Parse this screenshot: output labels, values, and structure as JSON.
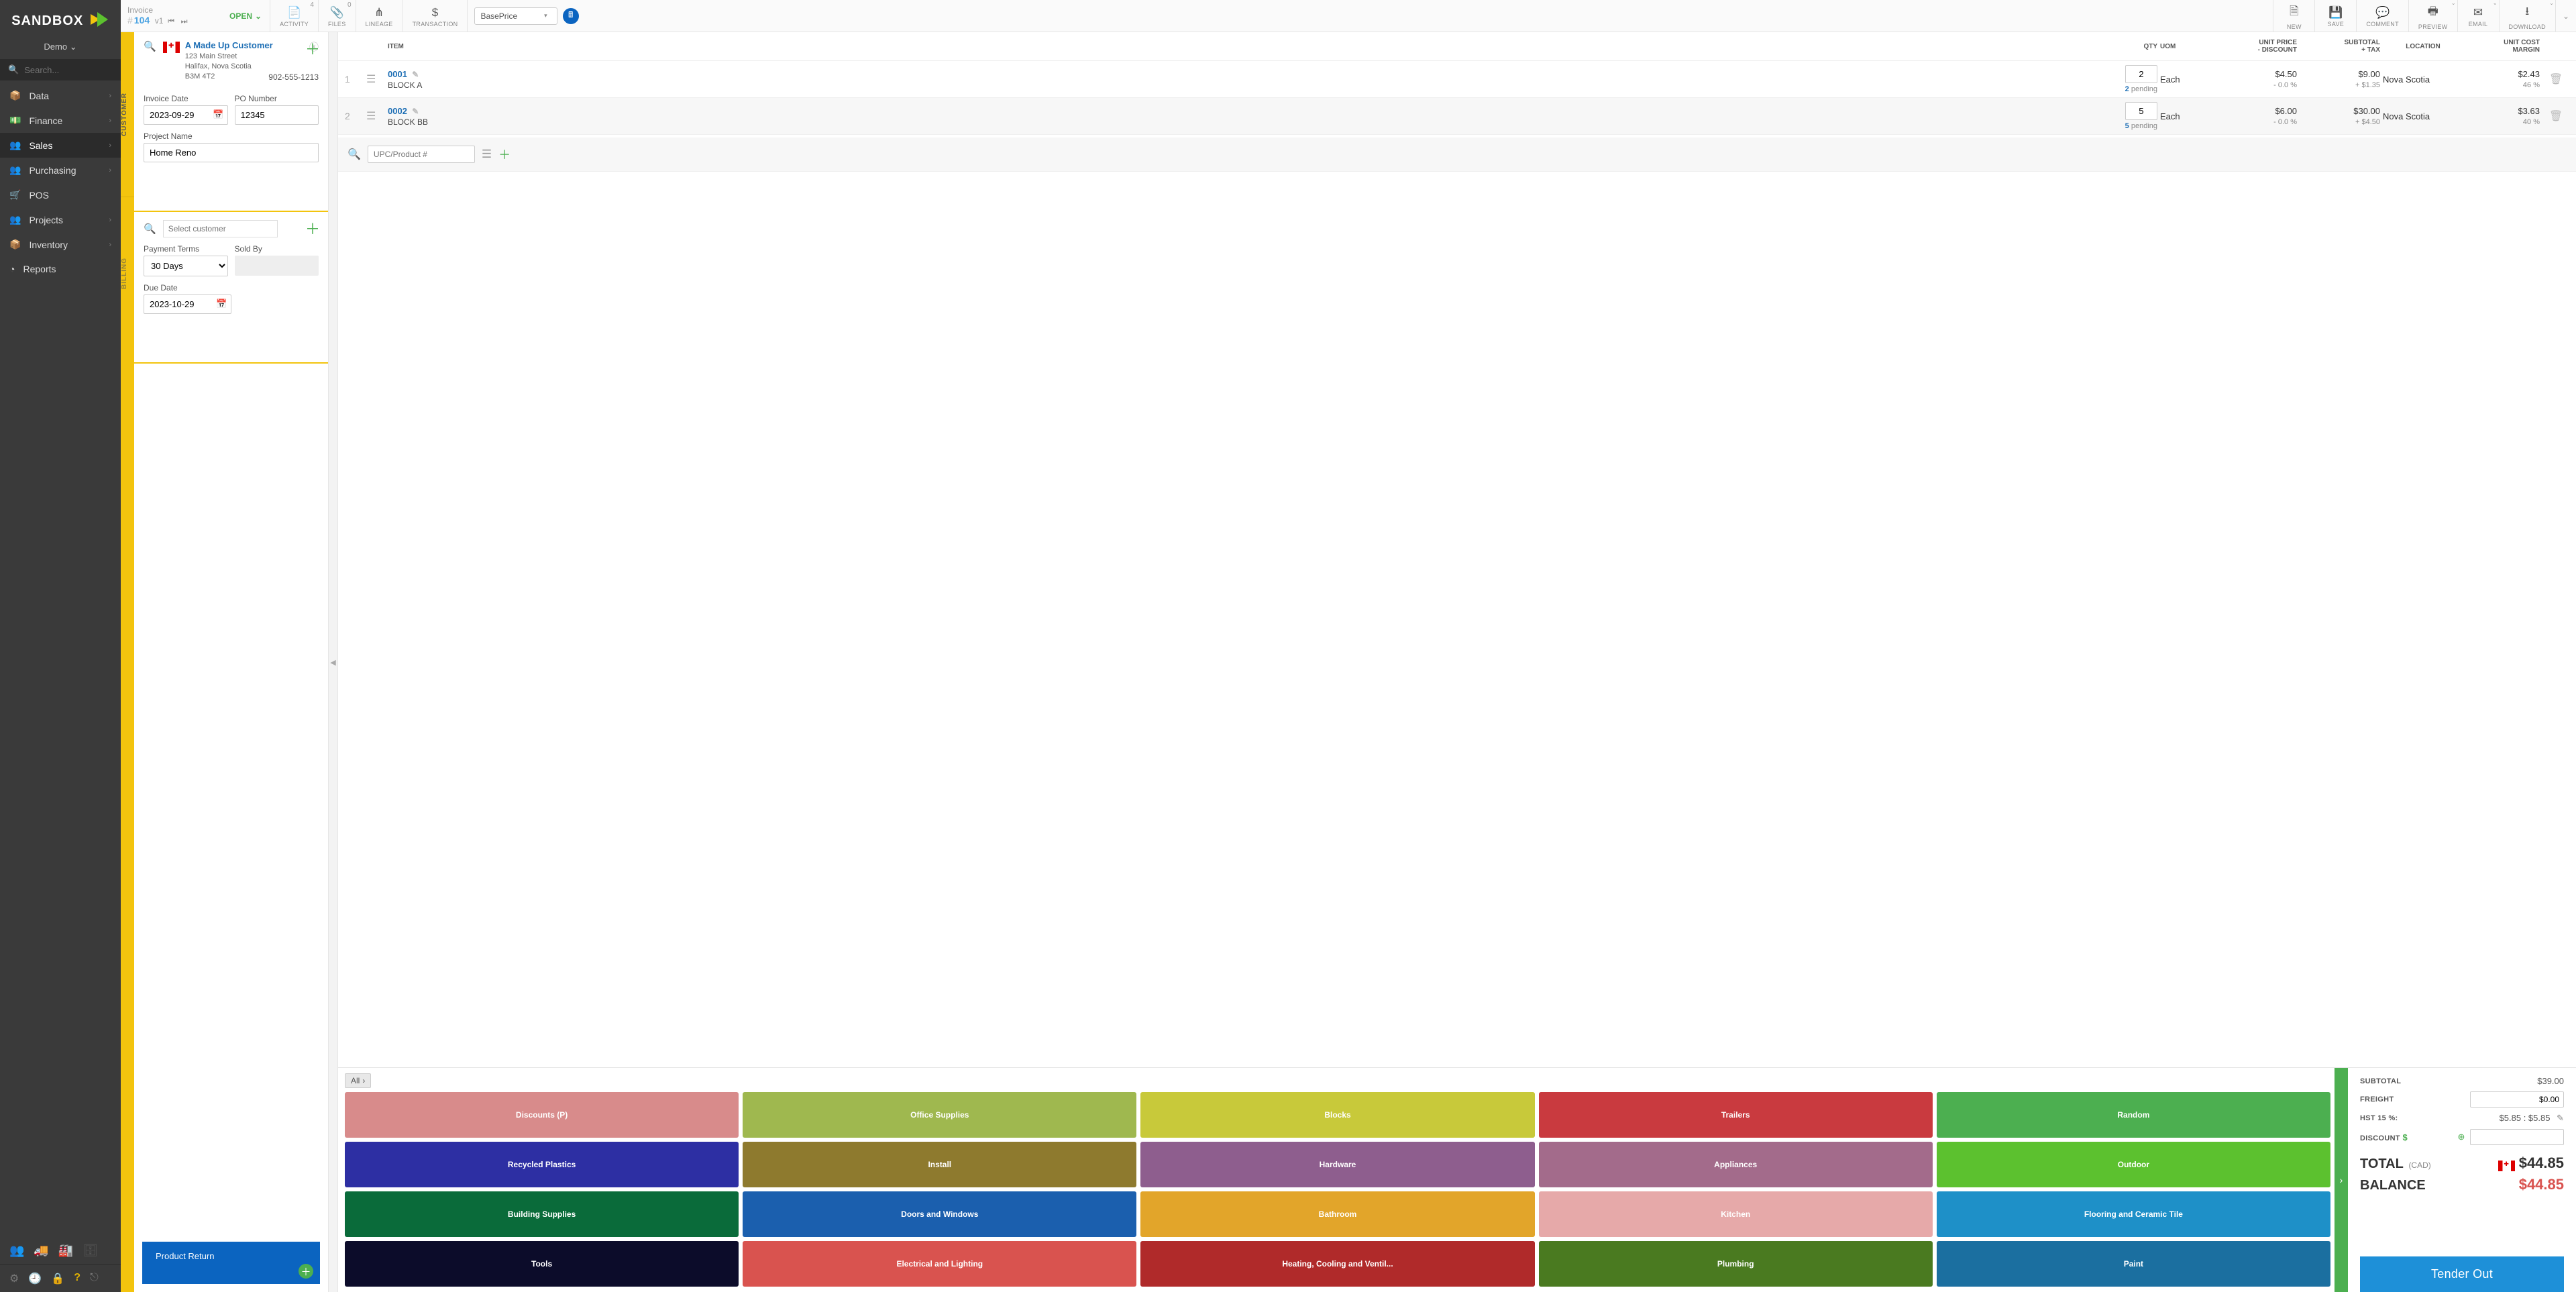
{
  "brand": "SANDBOX",
  "tenant": "Demo",
  "search_placeholder": "Search...",
  "nav": [
    {
      "label": "Data",
      "expandable": true
    },
    {
      "label": "Finance",
      "expandable": true
    },
    {
      "label": "Sales",
      "expandable": true,
      "active": true
    },
    {
      "label": "Purchasing",
      "expandable": true
    },
    {
      "label": "POS",
      "expandable": false
    },
    {
      "label": "Projects",
      "expandable": true
    },
    {
      "label": "Inventory",
      "expandable": true
    },
    {
      "label": "Reports",
      "expandable": false
    }
  ],
  "ribbon": {
    "doc_type": "Invoice",
    "doc_hash": "#",
    "doc_id": "104",
    "version": "v1",
    "status": "OPEN",
    "tools_left": [
      {
        "id": "activity",
        "label": "ACTIVITY",
        "count": "4",
        "glyph": "📄"
      },
      {
        "id": "files",
        "label": "FILES",
        "count": "0",
        "glyph": "📎"
      },
      {
        "id": "lineage",
        "label": "LINEAGE",
        "glyph": "⋔"
      },
      {
        "id": "transaction",
        "label": "TRANSACTION",
        "glyph": "$"
      }
    ],
    "price_select": "BasePrice",
    "tools_right": [
      {
        "id": "new",
        "label": "NEW",
        "glyph": "🗎"
      },
      {
        "id": "save",
        "label": "SAVE",
        "glyph": "💾"
      },
      {
        "id": "comment",
        "label": "COMMENT",
        "glyph": "💬"
      },
      {
        "id": "preview",
        "label": "PREVIEW",
        "glyph": "🖶",
        "drop": true
      },
      {
        "id": "email",
        "label": "EMAIL",
        "glyph": "✉",
        "drop": true
      },
      {
        "id": "download",
        "label": "DOWNLOAD",
        "glyph": "⭳",
        "drop": true
      }
    ]
  },
  "side_tabs": [
    "CUSTOMER",
    "BILLING"
  ],
  "customer": {
    "name": "A Made Up Customer",
    "addr1": "123 Main Street",
    "addr2": "Halifax, Nova Scotia",
    "addr3": "B3M 4T2",
    "phone": "902-555-1213",
    "invoice_date_label": "Invoice Date",
    "invoice_date": "2023-09-29",
    "po_label": "PO Number",
    "po": "12345",
    "project_label": "Project Name",
    "project": "Home Reno"
  },
  "billing": {
    "select_placeholder": "Select customer",
    "payment_terms_label": "Payment Terms",
    "payment_terms": "30 Days",
    "sold_by_label": "Sold By",
    "due_date_label": "Due Date",
    "due_date": "2023-10-29"
  },
  "product_return_label": "Product Return",
  "grid": {
    "headers": {
      "item": "ITEM",
      "qty": "QTY",
      "uom": "UOM",
      "unit_price_a": "UNIT PRICE",
      "unit_price_b": "- DISCOUNT",
      "subtotal_a": "SUBTOTAL",
      "subtotal_b": "+ TAX",
      "location": "LOCATION",
      "cost_a": "UNIT COST",
      "cost_b": "MARGIN"
    },
    "add_placeholder": "UPC/Product #"
  },
  "lines": [
    {
      "idx": "1",
      "code": "0001",
      "name": "BLOCK A",
      "qty": "2",
      "pending_qty": "2",
      "pending_txt": "pending",
      "uom": "Each",
      "price": "$4.50",
      "disc": "- 0.0 %",
      "sub": "$9.00",
      "tax": "+ $1.35",
      "loc": "Nova Scotia",
      "cost": "$2.43",
      "margin": "46 %"
    },
    {
      "idx": "2",
      "code": "0002",
      "name": "BLOCK BB",
      "qty": "5",
      "pending_qty": "5",
      "pending_txt": "pending",
      "uom": "Each",
      "price": "$6.00",
      "disc": "- 0.0 %",
      "sub": "$30.00",
      "tax": "+ $4.50",
      "loc": "Nova Scotia",
      "cost": "$3.63",
      "margin": "40 %"
    }
  ],
  "categories_crumb": "All",
  "categories": [
    {
      "label": "Discounts (P)",
      "color": "#d88b8b"
    },
    {
      "label": "Office Supplies",
      "color": "#9fb84f"
    },
    {
      "label": "Blocks",
      "color": "#c8c93a"
    },
    {
      "label": "Trailers",
      "color": "#c93a3f"
    },
    {
      "label": "Random",
      "color": "#4caf50"
    },
    {
      "label": "Recycled Plastics",
      "color": "#2d2fa3"
    },
    {
      "label": "Install",
      "color": "#8e7a2e"
    },
    {
      "label": "Hardware",
      "color": "#8e5e8e"
    },
    {
      "label": "Appliances",
      "color": "#a36b8b"
    },
    {
      "label": "Outdoor",
      "color": "#5cc12f"
    },
    {
      "label": "Building Supplies",
      "color": "#0a6b3a"
    },
    {
      "label": "Doors and Windows",
      "color": "#1b5fae"
    },
    {
      "label": "Bathroom",
      "color": "#e2a52a"
    },
    {
      "label": "Kitchen",
      "color": "#e6a9a9"
    },
    {
      "label": "Flooring and Ceramic Tile",
      "color": "#1e90c8"
    },
    {
      "label": "Tools",
      "color": "#0c0c2a"
    },
    {
      "label": "Electrical and Lighting",
      "color": "#d9534f"
    },
    {
      "label": "Heating, Cooling and Ventil...",
      "color": "#b02a2a"
    },
    {
      "label": "Plumbing",
      "color": "#4a7a20"
    },
    {
      "label": "Paint",
      "color": "#1b6fa0"
    }
  ],
  "totals": {
    "subtotal_label": "SUBTOTAL",
    "subtotal": "$39.00",
    "freight_label": "FREIGHT",
    "freight_value": "$0.00",
    "hst_label": "HST 15 %:",
    "hst": "$5.85 : $5.85",
    "discount_label": "DISCOUNT",
    "total_label": "TOTAL",
    "total_cur": "(CAD)",
    "total": "$44.85",
    "balance_label": "BALANCE",
    "balance": "$44.85"
  },
  "tender_label": "Tender Out"
}
